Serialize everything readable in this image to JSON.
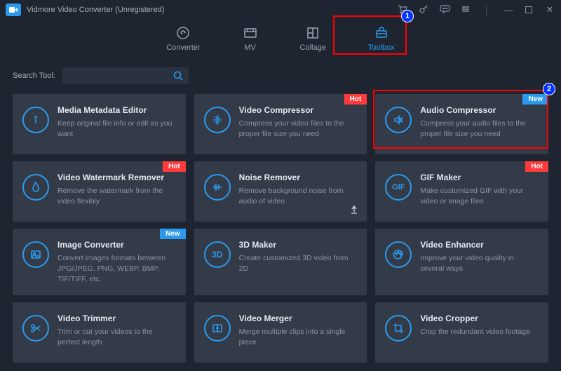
{
  "titlebar": {
    "title": "Vidmore Video Converter (Unregistered)"
  },
  "tabs": {
    "converter": "Converter",
    "mv": "MV",
    "collage": "Collage",
    "toolbox": "Toolbox"
  },
  "search": {
    "label": "Search Tool:",
    "placeholder": ""
  },
  "badges": {
    "hot": "Hot",
    "new": "New"
  },
  "annotations": {
    "n1": "1",
    "n2": "2"
  },
  "tools": {
    "media_metadata": {
      "title": "Media Metadata Editor",
      "desc": "Keep original file info or edit as you want"
    },
    "video_compressor": {
      "title": "Video Compressor",
      "desc": "Compress your video files to the proper file size you need"
    },
    "audio_compressor": {
      "title": "Audio Compressor",
      "desc": "Compress your audio files to the proper file size you need"
    },
    "watermark_remover": {
      "title": "Video Watermark Remover",
      "desc": "Remove the watermark from the video flexibly"
    },
    "noise_remover": {
      "title": "Noise Remover",
      "desc": "Remove background noise from audio of video"
    },
    "gif_maker": {
      "title": "GIF Maker",
      "desc": "Make customized GIF with your video or image files"
    },
    "image_converter": {
      "title": "Image Converter",
      "desc": "Convert images formats between JPG/JPEG, PNG, WEBP, BMP, TIF/TIFF, etc."
    },
    "3d_maker": {
      "title": "3D Maker",
      "desc": "Create customized 3D video from 2D"
    },
    "video_enhancer": {
      "title": "Video Enhancer",
      "desc": "Improve your video quality in several ways"
    },
    "video_trimmer": {
      "title": "Video Trimmer",
      "desc": "Trim or cut your videos to the perfect length"
    },
    "video_merger": {
      "title": "Video Merger",
      "desc": "Merge multiple clips into a single piece"
    },
    "video_cropper": {
      "title": "Video Cropper",
      "desc": "Crop the redundant video footage"
    }
  }
}
